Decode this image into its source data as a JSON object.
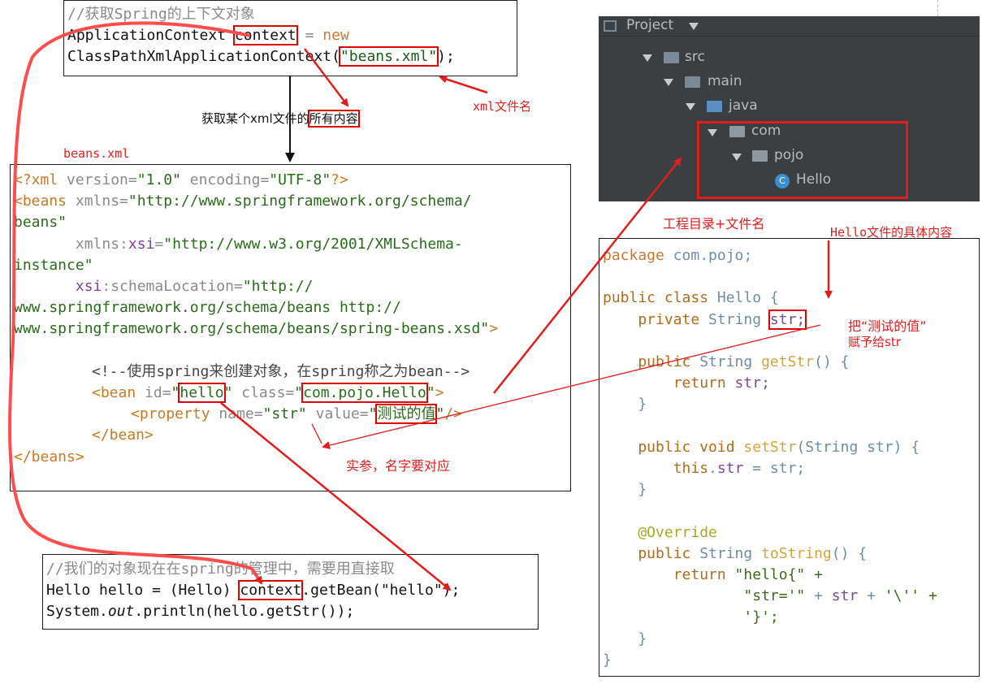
{
  "context_box": {
    "comment": "//获取Spring的上下文对象",
    "line2_a": "ApplicationContext ",
    "line2_var": "context",
    "line2_b": " = ",
    "line2_new": "new",
    "line3_a": "ClassPathXmlApplicationContext(",
    "line3_arg": "\"beans.xml\"",
    "line3_b": ");"
  },
  "labels": {
    "get_xml_prefix": "获取某个xml文件的",
    "get_xml_highlight": "所有内容",
    "xml_filename": "xml文件名",
    "beans_xml": "beans.xml",
    "project_dir": "工程目录+文件名",
    "hello_content": "Hello文件的具体内容",
    "assign_value_1": "把“测试的值”",
    "assign_value_2": "赋予给str",
    "actual_param": "实参，名字要对应"
  },
  "xml_box": {
    "l1": [
      "<?xml",
      " version=",
      "\"1.0\"",
      " encoding=",
      "\"UTF-8\"",
      "?>"
    ],
    "l2": [
      "<beans",
      " xmlns=",
      "\"http://www.springframework.org/schema/"
    ],
    "l3": "beans\"",
    "l4": [
      "       xmlns:",
      "xsi",
      "=",
      "\"http://www.w3.org/2001/XMLSchema-"
    ],
    "l5": "instance\"",
    "l6": [
      "       ",
      "xsi",
      ":schemaLocation=",
      "\"http://"
    ],
    "l7": "www.springframework.org/schema/beans http://",
    "l8": [
      "www.springframework.org/schema/beans/spring-beans.xsd\"",
      ">"
    ],
    "l9": "<!--使用spring来创建对象，在spring称之为bean-->",
    "l10": [
      "<bean",
      " id=",
      "\"",
      "hello",
      "\"",
      " class=",
      "\"",
      "com.pojo.Hello",
      "\"",
      ">"
    ],
    "l11": [
      "<property",
      " name=",
      "\"str\"",
      " value=",
      "\"",
      "测试的值",
      "\"",
      "/>"
    ],
    "l12": "</bean>",
    "l13": "</beans>"
  },
  "main_box": {
    "comment": "//我们的对象现在在spring的管理中，需要用直接取",
    "l2_a": "Hello hello = (Hello) ",
    "l2_var": "context",
    "l2_b": ".getBean(\"hello\");",
    "l3_a": "System.",
    "l3_out": "out",
    "l3_b": ".println(hello.getStr());"
  },
  "project_tree": {
    "header": "Project",
    "items": [
      {
        "label": "src",
        "icon": "folder-icon"
      },
      {
        "label": "main",
        "icon": "folder-icon"
      },
      {
        "label": "java",
        "icon": "source-folder-icon"
      },
      {
        "label": "com",
        "icon": "package-icon"
      },
      {
        "label": "pojo",
        "icon": "package-icon"
      },
      {
        "label": "Hello",
        "icon": "class-icon",
        "badge": "C"
      }
    ]
  },
  "hello_box": {
    "l1": [
      "package",
      " com.pojo;"
    ],
    "l3": [
      "public class",
      " Hello {"
    ],
    "l4": [
      "    private",
      " String ",
      "str;"
    ],
    "l6": [
      "    public",
      " String ",
      "getStr",
      "() {"
    ],
    "l7": [
      "        return",
      " str;"
    ],
    "l8": "    }",
    "l10": [
      "    public void",
      " ",
      "setStr",
      "(String str) {"
    ],
    "l11": [
      "        this",
      ".",
      "str",
      " = str;"
    ],
    "l12": "    }",
    "l14": "    @Override",
    "l15": [
      "    public",
      " String ",
      "toString",
      "() {"
    ],
    "l16": [
      "        return",
      " \"hello{\" +"
    ],
    "l17": [
      "                \"str='\"",
      " + ",
      "str",
      " + ",
      "'\\'' +"
    ],
    "l18": "                '}';",
    "l19": "    }",
    "l20": "}"
  },
  "colors": {
    "annotation_red": "#e11d1d",
    "ide_dark": "#3c3f41",
    "curve_red": "#ff4d4d"
  }
}
